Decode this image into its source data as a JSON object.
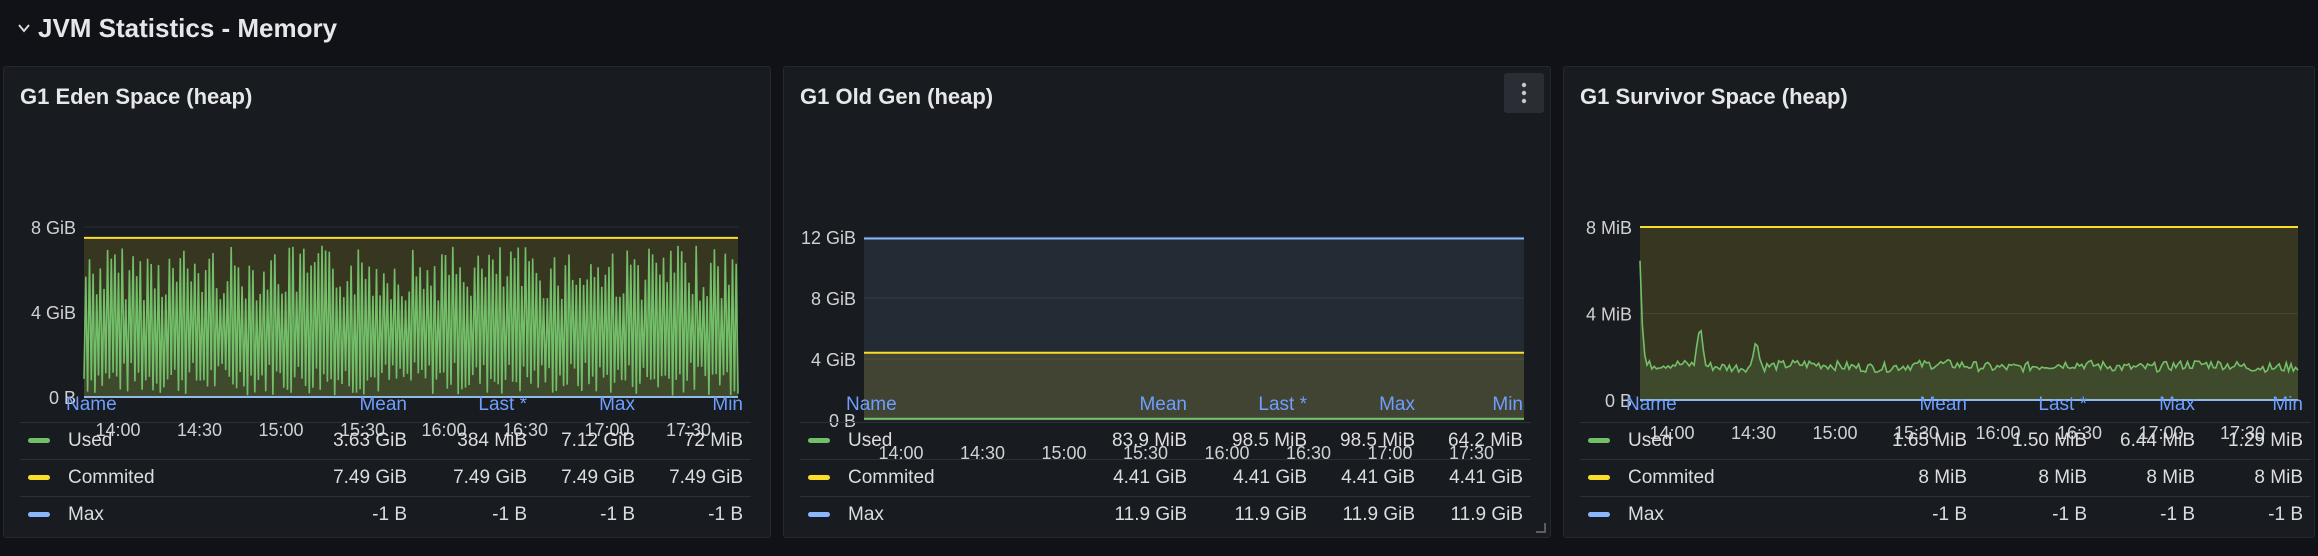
{
  "row": {
    "title": "JVM Statistics - Memory"
  },
  "colors": {
    "used": "#73bf69",
    "committed": "#fade2a",
    "max": "#8ab8ff",
    "grid": "#2a2d33",
    "axis_text": "#d0d1d5"
  },
  "legend_headers": {
    "name": "Name",
    "mean": "Mean",
    "last": "Last *",
    "max": "Max",
    "min": "Min"
  },
  "panels": [
    {
      "title": "G1 Eden Space (heap)",
      "legend": [
        {
          "name": "Used",
          "color": "#73bf69",
          "mean": "3.63 GiB",
          "last": "384 MiB",
          "max": "7.12 GiB",
          "min": "72 MiB"
        },
        {
          "name": "Commited",
          "color": "#fade2a",
          "mean": "7.49 GiB",
          "last": "7.49 GiB",
          "max": "7.49 GiB",
          "min": "7.49 GiB"
        },
        {
          "name": "Max",
          "color": "#8ab8ff",
          "mean": "-1 B",
          "last": "-1 B",
          "max": "-1 B",
          "min": "-1 B"
        }
      ]
    },
    {
      "title": "G1 Old Gen (heap)",
      "legend": [
        {
          "name": "Used",
          "color": "#73bf69",
          "mean": "83.9 MiB",
          "last": "98.5 MiB",
          "max": "98.5 MiB",
          "min": "64.2 MiB"
        },
        {
          "name": "Commited",
          "color": "#fade2a",
          "mean": "4.41 GiB",
          "last": "4.41 GiB",
          "max": "4.41 GiB",
          "min": "4.41 GiB"
        },
        {
          "name": "Max",
          "color": "#8ab8ff",
          "mean": "11.9 GiB",
          "last": "11.9 GiB",
          "max": "11.9 GiB",
          "min": "11.9 GiB"
        }
      ]
    },
    {
      "title": "G1 Survivor Space (heap)",
      "legend": [
        {
          "name": "Used",
          "color": "#73bf69",
          "mean": "1.65 MiB",
          "last": "1.50 MiB",
          "max": "6.44 MiB",
          "min": "1.29 MiB"
        },
        {
          "name": "Commited",
          "color": "#fade2a",
          "mean": "8 MiB",
          "last": "8 MiB",
          "max": "8 MiB",
          "min": "8 MiB"
        },
        {
          "name": "Max",
          "color": "#8ab8ff",
          "mean": "-1 B",
          "last": "-1 B",
          "max": "-1 B",
          "min": "-1 B"
        }
      ]
    }
  ],
  "chart_data": [
    {
      "type": "area",
      "x_ticks": [
        "14:00",
        "14:30",
        "15:00",
        "15:30",
        "16:00",
        "16:30",
        "17:00",
        "17:30"
      ],
      "y_ticks": [
        "0 B",
        "4 GiB",
        "8 GiB"
      ],
      "ylim": [
        0,
        8
      ],
      "series": [
        {
          "name": "Used",
          "pattern": "sawtooth",
          "min": 0.07,
          "max": 7.12
        },
        {
          "name": "Commited",
          "value": 7.49
        },
        {
          "name": "Max",
          "value": 0
        }
      ]
    },
    {
      "type": "area",
      "x_ticks": [
        "14:00",
        "14:30",
        "15:00",
        "15:30",
        "16:00",
        "16:30",
        "17:00",
        "17:30"
      ],
      "y_ticks": [
        "0 B",
        "4 GiB",
        "8 GiB",
        "12 GiB"
      ],
      "ylim": [
        0,
        12
      ],
      "series": [
        {
          "name": "Used",
          "value": 0.08
        },
        {
          "name": "Commited",
          "value": 4.41
        },
        {
          "name": "Max",
          "value": 11.9
        }
      ]
    },
    {
      "type": "area",
      "x_ticks": [
        "14:00",
        "14:30",
        "15:00",
        "15:30",
        "16:00",
        "16:30",
        "17:00",
        "17:30"
      ],
      "y_ticks": [
        "0 B",
        "4 MiB",
        "8 MiB"
      ],
      "ylim": [
        0,
        8
      ],
      "series": [
        {
          "name": "Used",
          "pattern": "noise",
          "min": 1.29,
          "max": 6.44,
          "mean": 1.65
        },
        {
          "name": "Commited",
          "value": 8
        },
        {
          "name": "Max",
          "value": 0
        }
      ]
    }
  ]
}
